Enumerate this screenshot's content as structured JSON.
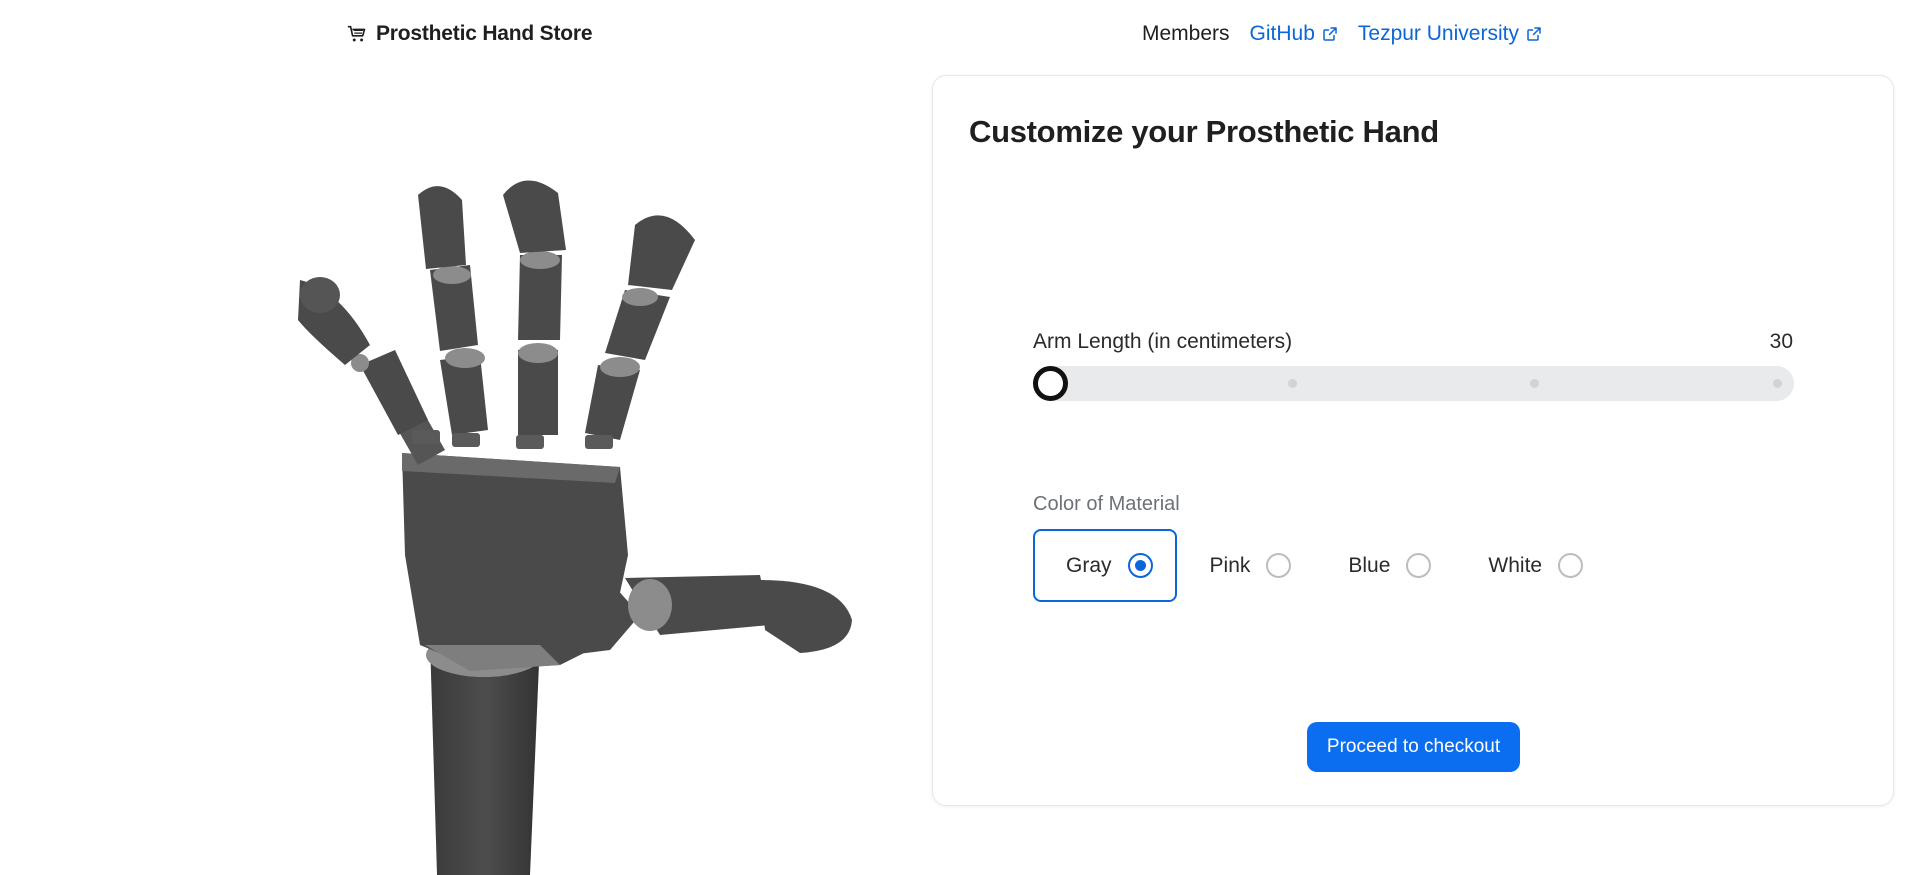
{
  "nav": {
    "brand": {
      "label": "Prosthetic Hand Store",
      "icon": "cart-icon"
    },
    "links": [
      {
        "label": "Members",
        "external": false
      },
      {
        "label": "GitHub",
        "external": true,
        "icon": "external-link-icon"
      },
      {
        "label": "Tezpur University",
        "external": true,
        "icon": "external-link-icon"
      }
    ]
  },
  "configurator": {
    "title": "Customize your Prosthetic Hand",
    "arm_length": {
      "label": "Arm Length (in centimeters)",
      "value": "30",
      "step_count": 4,
      "selected_step": 0
    },
    "color": {
      "label": "Color of Material",
      "options": [
        {
          "label": "Gray",
          "selected": true
        },
        {
          "label": "Pink",
          "selected": false
        },
        {
          "label": "Blue",
          "selected": false
        },
        {
          "label": "White",
          "selected": false
        }
      ]
    },
    "checkout_label": "Proceed to checkout"
  },
  "colors": {
    "accent": "#0b66d9",
    "button": "#0b6ef0",
    "hand_material": "#4a4a4a",
    "hand_joint": "#8c8c8c"
  }
}
